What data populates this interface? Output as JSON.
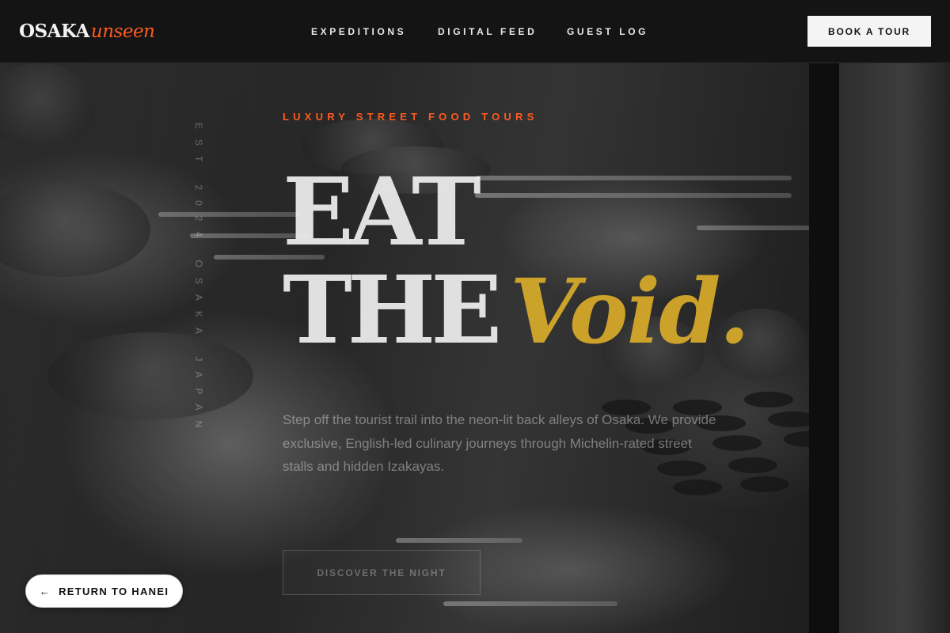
{
  "brand": {
    "name_main": "OSAKA",
    "name_accent": "unseen"
  },
  "nav": {
    "items": [
      {
        "label": "EXPEDITIONS"
      },
      {
        "label": "DIGITAL FEED"
      },
      {
        "label": "GUEST LOG"
      }
    ],
    "cta_label": "BOOK A TOUR"
  },
  "hero": {
    "vertical_caption": "EST 2024 OSAKA JAPAN",
    "eyebrow": "LUXURY STREET FOOD TOURS",
    "headline_line1": "EAT",
    "headline_line2": "THE",
    "headline_accent": "Void.",
    "lede": "Step off the tourist trail into the neon-lit back alleys of Osaka. We provide exclusive, English-led culinary journeys through Michelin-rated street stalls and hidden Izakayas.",
    "cta_label": "DISCOVER THE NIGHT"
  },
  "floating": {
    "return_arrow": "←",
    "return_label": "RETURN TO HANEI"
  },
  "colors": {
    "accent_orange": "#ff5a1f",
    "accent_gold": "#d4a82a",
    "header_bg": "#141414"
  }
}
